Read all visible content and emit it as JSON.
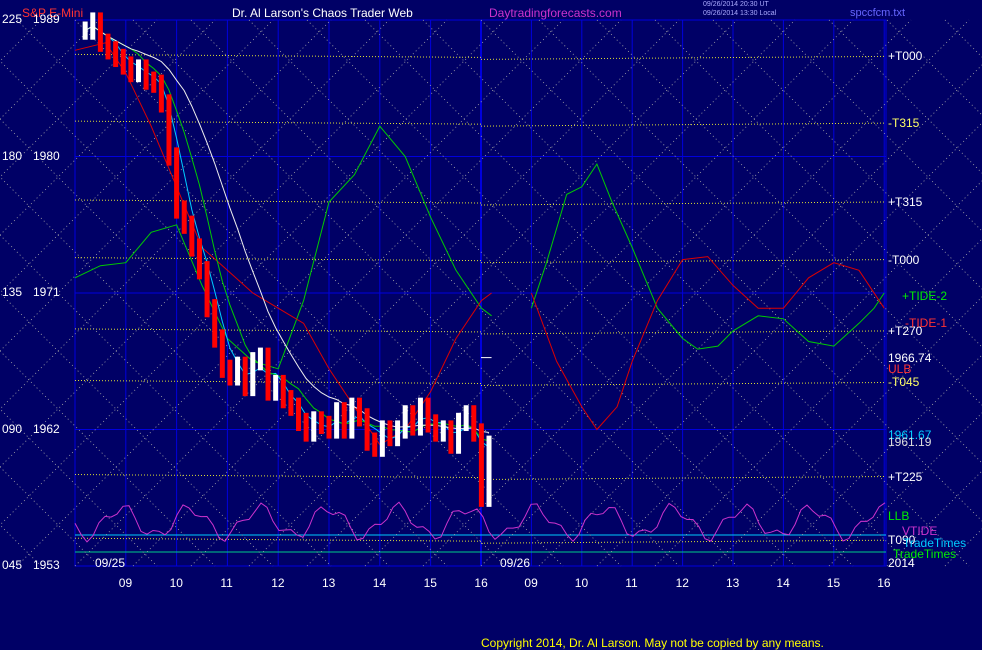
{
  "header": {
    "instrument": "S&P E-Mini",
    "title": "Dr. Al Larson's Chaos Trader Web",
    "site": "Daytradingforecasts.com",
    "time1": "09/26/2014 20:30 UT",
    "time2": "09/26/2014 13:30 Local",
    "file": "spccfcm.txt"
  },
  "colors": {
    "background": "#000066",
    "grid": "#0000dd",
    "price_up": "#ffffff",
    "price_down": "#ff0000",
    "cyan_ma": "#00ccff",
    "green_ma": "#00cc00",
    "white_ma": "#eeeeee",
    "red_ma": "#dd0000",
    "tide1": "#dd0000",
    "tide2": "#00cc00",
    "vtide": "#cc33cc",
    "electron_lines": "#dddd33",
    "diamond": "#aaaaaa"
  },
  "footer": {
    "copyright": "Copyright 2014, Dr. Al Larson. May not be copied by any means."
  },
  "chart_data": {
    "type": "line",
    "title": "S&P E-Mini",
    "y_left_scale": {
      "ticks": [
        "225",
        "180",
        "135",
        "090",
        "045"
      ],
      "range": [
        45,
        225
      ]
    },
    "y_price": {
      "ticks": [
        "1989",
        "1980",
        "1971",
        "1962",
        "1953"
      ],
      "range": [
        1953,
        1989
      ]
    },
    "x_ticks_day1": [
      "09",
      "10",
      "11",
      "12",
      "13",
      "14",
      "15",
      "16"
    ],
    "x_ticks_day2": [
      "09",
      "10",
      "11",
      "12",
      "13",
      "14",
      "15",
      "16"
    ],
    "day_labels": [
      "09/25",
      "09/26"
    ],
    "year_label": "2014",
    "price_close_marker": {
      "label": "1966.74",
      "value": 1966.74
    },
    "right_labels": [
      {
        "text": "+T000",
        "value": 1986.6,
        "color": "#ffffff"
      },
      {
        "text": "-T315",
        "value": 1982.2,
        "color": "#ffff66"
      },
      {
        "text": "+T315",
        "value": 1977.0,
        "color": "#ffffff"
      },
      {
        "text": "-T000",
        "value": 1973.2,
        "color": "#ffffff"
      },
      {
        "text": "+T270",
        "value": 1968.5,
        "color": "#ffffff"
      },
      {
        "text": "-T045",
        "value": 1965.1,
        "color": "#ffff66"
      },
      {
        "text": "+T225",
        "value": 1958.9,
        "color": "#ffffff"
      },
      {
        "text": "+TIDE-2",
        "value": 1970.8,
        "color": "#00ee00"
      },
      {
        "text": "-TIDE-1",
        "value": 1969.0,
        "color": "#ff3333"
      },
      {
        "text": "ULB",
        "value": 1966.0,
        "color": "#ff3333"
      },
      {
        "text": "1961.67",
        "value": 1961.67,
        "color": "#00ccff"
      },
      {
        "text": "1961.19",
        "value": 1961.19,
        "color": "#dddddd"
      },
      {
        "text": "LLB",
        "value": 1956.3,
        "color": "#00ee00"
      },
      {
        "text": "VTIDE",
        "value": 1955.3,
        "color": "#cc33cc"
      },
      {
        "text": "T090",
        "value": 1954.7,
        "color": "#ffffff"
      },
      {
        "text": "TradeTimes",
        "value": 1954.5,
        "color": "#00ccff"
      },
      {
        "text": "TradeTimes",
        "value": 1953.8,
        "color": "#00ee00"
      }
    ],
    "price_day1": [
      [
        8.2,
        1988.3
      ],
      [
        8.35,
        1988.9
      ],
      [
        8.5,
        1987.5
      ],
      [
        8.65,
        1987.0
      ],
      [
        8.8,
        1986.5
      ],
      [
        8.95,
        1986.0
      ],
      [
        9.1,
        1985.5
      ],
      [
        9.25,
        1985.8
      ],
      [
        9.4,
        1985.0
      ],
      [
        9.55,
        1984.8
      ],
      [
        9.7,
        1983.5
      ],
      [
        9.85,
        1980.0
      ],
      [
        10.0,
        1976.5
      ],
      [
        10.15,
        1975.5
      ],
      [
        10.3,
        1974.0
      ],
      [
        10.45,
        1972.5
      ],
      [
        10.6,
        1970.0
      ],
      [
        10.75,
        1968.0
      ],
      [
        10.9,
        1966.0
      ],
      [
        11.05,
        1965.5
      ],
      [
        11.2,
        1966.2
      ],
      [
        11.35,
        1964.8
      ],
      [
        11.5,
        1966.5
      ],
      [
        11.65,
        1966.8
      ],
      [
        11.8,
        1964.5
      ],
      [
        11.95,
        1965.0
      ],
      [
        12.1,
        1964.0
      ],
      [
        12.25,
        1963.5
      ],
      [
        12.4,
        1962.5
      ],
      [
        12.55,
        1961.8
      ],
      [
        12.7,
        1962.6
      ],
      [
        12.85,
        1962.3
      ],
      [
        13.0,
        1962.0
      ],
      [
        13.15,
        1963.2
      ],
      [
        13.3,
        1962.0
      ],
      [
        13.45,
        1963.5
      ],
      [
        13.6,
        1962.8
      ],
      [
        13.75,
        1961.2
      ],
      [
        13.9,
        1960.8
      ],
      [
        14.05,
        1962.0
      ],
      [
        14.2,
        1961.5
      ],
      [
        14.35,
        1962.0
      ],
      [
        14.5,
        1963.0
      ],
      [
        14.65,
        1962.2
      ],
      [
        14.8,
        1963.5
      ],
      [
        14.95,
        1962.4
      ],
      [
        15.1,
        1961.8
      ],
      [
        15.25,
        1962.0
      ],
      [
        15.4,
        1961.0
      ],
      [
        15.55,
        1962.5
      ],
      [
        15.7,
        1963.0
      ],
      [
        15.85,
        1961.8
      ],
      [
        16.0,
        1957.5
      ],
      [
        16.15,
        1961.0
      ]
    ],
    "tide2_day1": [
      [
        8.0,
        1972.0
      ],
      [
        8.5,
        1972.8
      ],
      [
        9.0,
        1973.0
      ],
      [
        9.5,
        1975.0
      ],
      [
        10.0,
        1975.5
      ],
      [
        10.5,
        1971.5
      ],
      [
        11.0,
        1968.0
      ],
      [
        11.5,
        1966.5
      ],
      [
        12.0,
        1966.0
      ],
      [
        12.5,
        1970.5
      ],
      [
        13.0,
        1977.0
      ],
      [
        13.5,
        1978.8
      ],
      [
        14.0,
        1982.0
      ],
      [
        14.5,
        1980.0
      ],
      [
        15.0,
        1976.0
      ],
      [
        15.5,
        1972.5
      ],
      [
        16.0,
        1970.0
      ],
      [
        16.2,
        1969.5
      ]
    ],
    "tide1_day1": [
      [
        8.0,
        1987.0
      ],
      [
        8.6,
        1987.5
      ],
      [
        9.0,
        1985.5
      ],
      [
        9.5,
        1982.0
      ],
      [
        10.0,
        1978.0
      ],
      [
        10.5,
        1974.0
      ],
      [
        11.0,
        1972.5
      ],
      [
        11.5,
        1971.0
      ],
      [
        12.0,
        1970.0
      ],
      [
        12.5,
        1969.0
      ],
      [
        13.0,
        1966.0
      ],
      [
        13.5,
        1963.5
      ],
      [
        14.0,
        1961.0
      ],
      [
        14.5,
        1962.0
      ],
      [
        15.0,
        1964.5
      ],
      [
        15.5,
        1968.0
      ],
      [
        16.0,
        1970.5
      ],
      [
        16.2,
        1971.0
      ]
    ],
    "tide2_day2": [
      [
        9.0,
        1970.0
      ],
      [
        9.3,
        1973.0
      ],
      [
        9.7,
        1977.5
      ],
      [
        10.0,
        1978.0
      ],
      [
        10.3,
        1979.5
      ],
      [
        10.6,
        1977.0
      ],
      [
        11.0,
        1974.0
      ],
      [
        11.5,
        1970.0
      ],
      [
        12.0,
        1968.0
      ],
      [
        12.3,
        1967.3
      ],
      [
        12.7,
        1967.5
      ],
      [
        13.0,
        1968.5
      ],
      [
        13.5,
        1969.5
      ],
      [
        14.0,
        1969.3
      ],
      [
        14.5,
        1967.8
      ],
      [
        15.0,
        1967.5
      ],
      [
        15.5,
        1969.0
      ],
      [
        15.8,
        1970.0
      ],
      [
        16.0,
        1971.0
      ]
    ],
    "tide1_day2": [
      [
        9.0,
        1971.0
      ],
      [
        9.5,
        1966.5
      ],
      [
        10.0,
        1963.5
      ],
      [
        10.3,
        1962.0
      ],
      [
        10.7,
        1963.5
      ],
      [
        11.0,
        1966.5
      ],
      [
        11.5,
        1970.5
      ],
      [
        12.0,
        1973.2
      ],
      [
        12.5,
        1973.4
      ],
      [
        13.0,
        1971.5
      ],
      [
        13.5,
        1970.0
      ],
      [
        14.0,
        1970.0
      ],
      [
        14.5,
        1972.0
      ],
      [
        15.0,
        1973.0
      ],
      [
        15.5,
        1972.5
      ],
      [
        16.0,
        1970.0
      ]
    ]
  }
}
